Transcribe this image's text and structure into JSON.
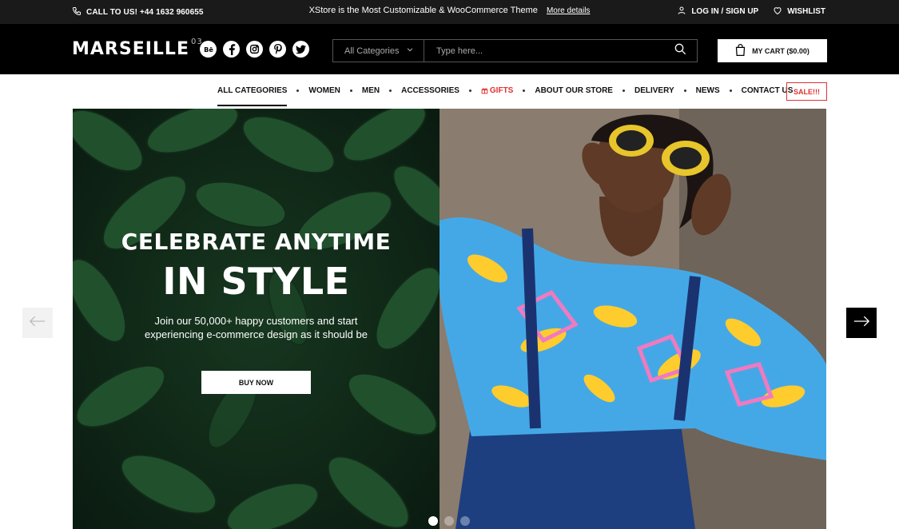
{
  "topbar": {
    "call_label": "CALL TO US! +44 1632 960655",
    "promo_text": "XStore is the Most Customizable & WooCommerce Theme",
    "promo_link": "More details",
    "login_label": "LOG IN / SIGN UP",
    "wishlist_label": "WISHLIST"
  },
  "header": {
    "logo": "MARSEILLE",
    "logo_sup": "03",
    "social_icons": [
      "behance-icon",
      "facebook-icon",
      "instagram-icon",
      "pinterest-icon",
      "twitter-icon"
    ],
    "search": {
      "category": "All Categories",
      "placeholder": "Type here..."
    },
    "cart_label": "MY CART ($0.00)"
  },
  "nav": {
    "items": [
      {
        "label": "ALL CATEGORIES"
      },
      {
        "label": "WOMEN"
      },
      {
        "label": "MEN"
      },
      {
        "label": "ACCESSORIES"
      },
      {
        "label": "GIFTS"
      },
      {
        "label": "ABOUT OUR STORE"
      },
      {
        "label": "DELIVERY"
      },
      {
        "label": "NEWS"
      },
      {
        "label": "CONTACT US"
      }
    ],
    "sale_label": "SALE!!!",
    "accent": "#e03131"
  },
  "hero": {
    "title_line1": "CELEBRATE ANYTIME",
    "title_line2": "IN STYLE",
    "subtitle": "Join our 50,000+ happy customers and start experiencing e-commerce design as it should be",
    "button": "BUY NOW",
    "slides": 3,
    "active_slide": 1
  }
}
